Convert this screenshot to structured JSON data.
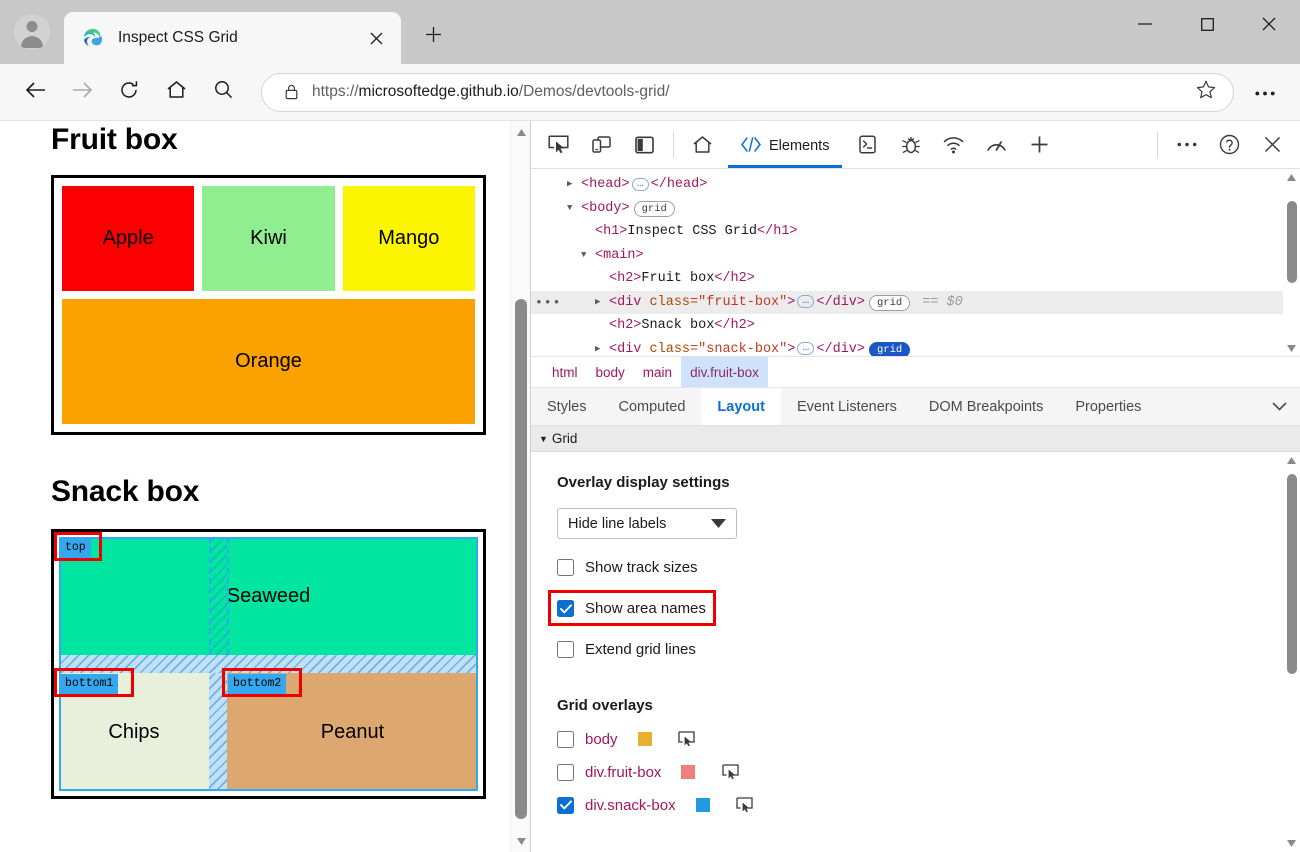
{
  "browser": {
    "tab": {
      "title": "Inspect CSS Grid",
      "favicon_icon": "edge-logo-icon",
      "close_icon": "close-icon"
    },
    "new_tab_icon": "plus-icon",
    "profile_icon": "profile-avatar-icon",
    "window_controls": {
      "minimize": "minimize-icon",
      "maximize": "maximize-icon",
      "close": "close-icon"
    },
    "nav": {
      "back_icon": "back-arrow-icon",
      "forward_icon": "forward-arrow-icon",
      "reload_icon": "reload-icon",
      "home_icon": "home-icon",
      "search_icon": "search-icon",
      "lock_icon": "lock-icon",
      "star_icon": "star-icon",
      "more_icon": "ellipsis-icon"
    },
    "url_prefix": "https://",
    "url_host": "microsoftedge.github.io",
    "url_path": "/Demos/devtools-grid/",
    "url_full": "https://microsoftedge.github.io/Demos/devtools-grid/"
  },
  "page": {
    "heading_fruit": "Fruit box",
    "heading_snack": "Snack box",
    "fruit_items": [
      {
        "label": "Apple",
        "color": "#fb0000"
      },
      {
        "label": "Kiwi",
        "color": "#90ee90"
      },
      {
        "label": "Mango",
        "color": "#fbf500"
      },
      {
        "label": "Orange",
        "color": "#fba100"
      }
    ],
    "snack_items": [
      {
        "label": "Seaweed",
        "color": "#00e5a0",
        "area": "top"
      },
      {
        "label": "Chips",
        "color": "#e8f0dc",
        "area": "bottom1"
      },
      {
        "label": "Peanut",
        "color": "#dda870",
        "area": "bottom2"
      }
    ],
    "overlay_color": "#33a8ee",
    "annotation_color": "#ee0000"
  },
  "devtools": {
    "toolbar_icons": [
      "inspect-element-icon",
      "device-emulation-icon",
      "dock-side-icon",
      "home-icon",
      "console-icon",
      "debugger-icon",
      "network-icon",
      "performance-icon",
      "add-panel-icon",
      "more-tools-icon",
      "help-icon",
      "close-devtools-icon"
    ],
    "active_panel": "Elements",
    "dom": {
      "rows": [
        {
          "indent": 1,
          "triangle": "collapsed",
          "text": "<head>…</head>"
        },
        {
          "indent": 1,
          "triangle": "expanded",
          "text": "<body>",
          "badge": "grid",
          "badge_on": false
        },
        {
          "indent": 2,
          "triangle": "none",
          "text": "<h1>Inspect CSS Grid</h1>"
        },
        {
          "indent": 2,
          "triangle": "expanded",
          "text": "<main>"
        },
        {
          "indent": 3,
          "triangle": "none",
          "text": "<h2>Fruit box</h2>"
        },
        {
          "indent": 3,
          "triangle": "collapsed",
          "text": "<div class=\"fruit-box\">…</div>",
          "badge": "grid",
          "badge_on": false,
          "selected": true,
          "suffix": "== $0"
        },
        {
          "indent": 3,
          "triangle": "none",
          "text": "<h2>Snack box</h2>"
        },
        {
          "indent": 3,
          "triangle": "collapsed",
          "text": "<div class=\"snack-box\">…</div>",
          "badge": "grid",
          "badge_on": true
        }
      ],
      "tags": {
        "head": "head",
        "body": "body",
        "h1": "h1",
        "main": "main",
        "h2": "h2",
        "div": "div",
        "h1_text": "Inspect CSS Grid",
        "h2_fruit": "Fruit box",
        "h2_snack": "Snack box",
        "class_attr": "class",
        "fruit_class": "fruit-box",
        "snack_class": "snack-box",
        "badge_label": "grid",
        "selected_marker": "== $0",
        "gutter_dots": "•••",
        "ellipsis": "•••"
      }
    },
    "breadcrumbs": [
      {
        "label": "html",
        "active": false
      },
      {
        "label": "body",
        "active": false
      },
      {
        "label": "main",
        "active": false
      },
      {
        "label": "div.fruit-box",
        "active": true
      }
    ],
    "subtabs": [
      {
        "label": "Styles",
        "active": false
      },
      {
        "label": "Computed",
        "active": false
      },
      {
        "label": "Layout",
        "active": true
      },
      {
        "label": "Event Listeners",
        "active": false
      },
      {
        "label": "DOM Breakpoints",
        "active": false
      },
      {
        "label": "Properties",
        "active": false
      }
    ],
    "subtabs_more_icon": "chevron-down-icon",
    "grid_section": {
      "label": "Grid",
      "expanded": true,
      "caret_icon": "caret-down-icon"
    },
    "overlay_settings": {
      "title": "Overlay display settings",
      "line_labels_select": {
        "value": "Hide line labels",
        "caret_icon": "caret-down-icon"
      },
      "checkboxes": [
        {
          "label": "Show track sizes",
          "checked": false,
          "highlighted": false
        },
        {
          "label": "Show area names",
          "checked": true,
          "highlighted": true
        },
        {
          "label": "Extend grid lines",
          "checked": false,
          "highlighted": false
        }
      ]
    },
    "grid_overlays": {
      "title": "Grid overlays",
      "items": [
        {
          "label": "body",
          "checked": false,
          "color": "#e8b02e",
          "goto_icon": "reveal-element-icon"
        },
        {
          "label": "div.fruit-box",
          "checked": false,
          "color": "#f08080",
          "goto_icon": "reveal-element-icon"
        },
        {
          "label": "div.snack-box",
          "checked": true,
          "color": "#2299e0",
          "goto_icon": "reveal-element-icon"
        }
      ]
    },
    "accent_color": "#0b6fd4"
  }
}
